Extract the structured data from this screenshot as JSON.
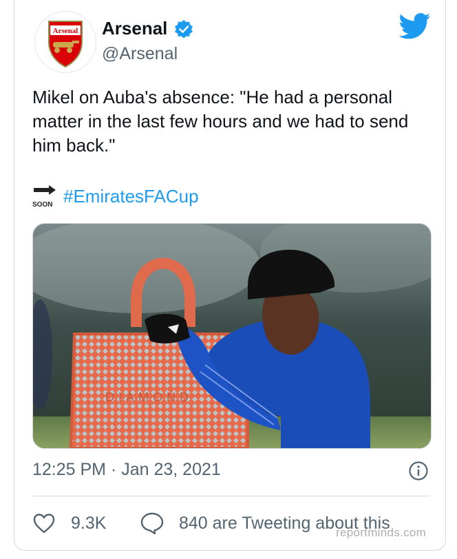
{
  "author": {
    "name": "Arsenal",
    "handle": "@Arsenal",
    "logo_text": "Arsenal"
  },
  "tweet": {
    "text": "Mikel on Auba's absence: \"He had a personal matter in the last few hours and we had to send him back.\"",
    "soon_label": "SOON",
    "hashtag": "#EmiratesFACup",
    "timestamp": "12:25 PM · Jan 23, 2021",
    "media_sign": "DIAMOND"
  },
  "actions": {
    "likes": "9.3K",
    "tweeting": "840 are Tweeting about this"
  },
  "watermark": "reportminds.com",
  "colors": {
    "accent": "#1d9bf0",
    "arsenal_red": "#db0007",
    "text": "#0f1419",
    "secondary": "#536471"
  },
  "icons": [
    "verified-icon",
    "twitter-bird-icon",
    "soon-arrow-icon",
    "info-icon",
    "heart-icon",
    "reply-bubble-icon"
  ]
}
